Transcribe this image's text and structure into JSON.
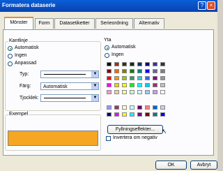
{
  "window": {
    "title": "Formatera dataserie",
    "help": "?",
    "close": "×"
  },
  "tabs": [
    "Mönster",
    "Form",
    "Datasetiketter",
    "Serieordning",
    "Alternativ"
  ],
  "border": {
    "title": "Kantlinje",
    "options": [
      "Automatisk",
      "Ingen",
      "Anpassad"
    ],
    "style_label": "Typ:",
    "color_label": "Färg:",
    "color_value": "Automatisk",
    "weight_label": "Tjocklek:"
  },
  "fill": {
    "title": "Yta",
    "options": [
      "Automatisk",
      "Ingen"
    ],
    "palette": [
      [
        "#000000",
        "#993300",
        "#333300",
        "#003300",
        "#003366",
        "#000080",
        "#333399",
        "#333333"
      ],
      [
        "#800000",
        "#ff6600",
        "#808000",
        "#008000",
        "#008080",
        "#0000ff",
        "#666699",
        "#808080"
      ],
      [
        "#ff0000",
        "#ff9900",
        "#99cc00",
        "#339966",
        "#33cccc",
        "#3366ff",
        "#800080",
        "#969696"
      ],
      [
        "#ff00ff",
        "#ffcc00",
        "#ffff00",
        "#00ff00",
        "#00ffff",
        "#00ccff",
        "#993366",
        "#c0c0c0"
      ],
      [
        "#ff99cc",
        "#ffcc99",
        "#ffff99",
        "#ccffcc",
        "#ccffff",
        "#99ccff",
        "#cc99ff",
        "#ffffff"
      ],
      [
        "#9999ff",
        "#993366",
        "#ffffcc",
        "#ccffff",
        "#660066",
        "#ff8080",
        "#0066cc",
        "#ccccff"
      ],
      [
        "#000080",
        "#ff00ff",
        "#ffff00",
        "#00ffff",
        "#800080",
        "#800000",
        "#008080",
        "#0000ff"
      ]
    ],
    "effects_button": "Fyllningseffekter...",
    "invert_label": "Invertera om negativ"
  },
  "sample": {
    "title": "Exempel",
    "color": "#f5a623"
  },
  "buttons": {
    "ok": "OK",
    "cancel": "Avbryt"
  }
}
